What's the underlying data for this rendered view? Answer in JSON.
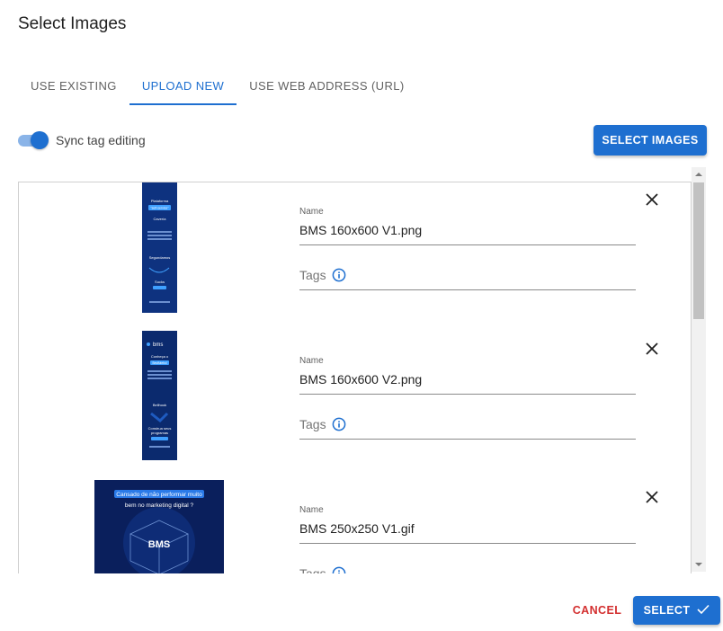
{
  "dialog": {
    "title": "Select Images"
  },
  "tabs": [
    {
      "label": "USE EXISTING",
      "active": false
    },
    {
      "label": "UPLOAD NEW",
      "active": true
    },
    {
      "label": "USE WEB ADDRESS (URL)",
      "active": false
    }
  ],
  "sync": {
    "label": "Sync tag editing",
    "enabled": true
  },
  "toolbar": {
    "select_images_label": "SELECT IMAGES"
  },
  "items": [
    {
      "name_label": "Name",
      "name_value": "BMS 160x600 V1.png",
      "tags_label": "Tags"
    },
    {
      "name_label": "Name",
      "name_value": "BMS 160x600 V2.png",
      "tags_label": "Tags"
    },
    {
      "name_label": "Name",
      "name_value": "BMS 250x250 V1.gif",
      "tags_label": "Tags"
    }
  ],
  "thumbnails": {
    "v1": {
      "l1": "Plataforma",
      "l2": "\"self-service\"",
      "l3": "Cavería",
      "l4": "Segundamos",
      "l5": "Sucks"
    },
    "v2": {
      "brand": "bms",
      "l1": "Conheça o",
      "l2": "Bestfutebol",
      "l3": "Bellhook",
      "l4": "Construa seus",
      "l5": "programas"
    },
    "v3": {
      "banner": "Cansado de não performar muito",
      "sub": "bem no marketing digital ?",
      "brand": "BMS"
    }
  },
  "footer": {
    "cancel_label": "CANCEL",
    "select_label": "SELECT"
  },
  "colors": {
    "accent": "#1e6fd0",
    "danger": "#d32f2f",
    "thumb_bg": "#0b2a6e"
  }
}
